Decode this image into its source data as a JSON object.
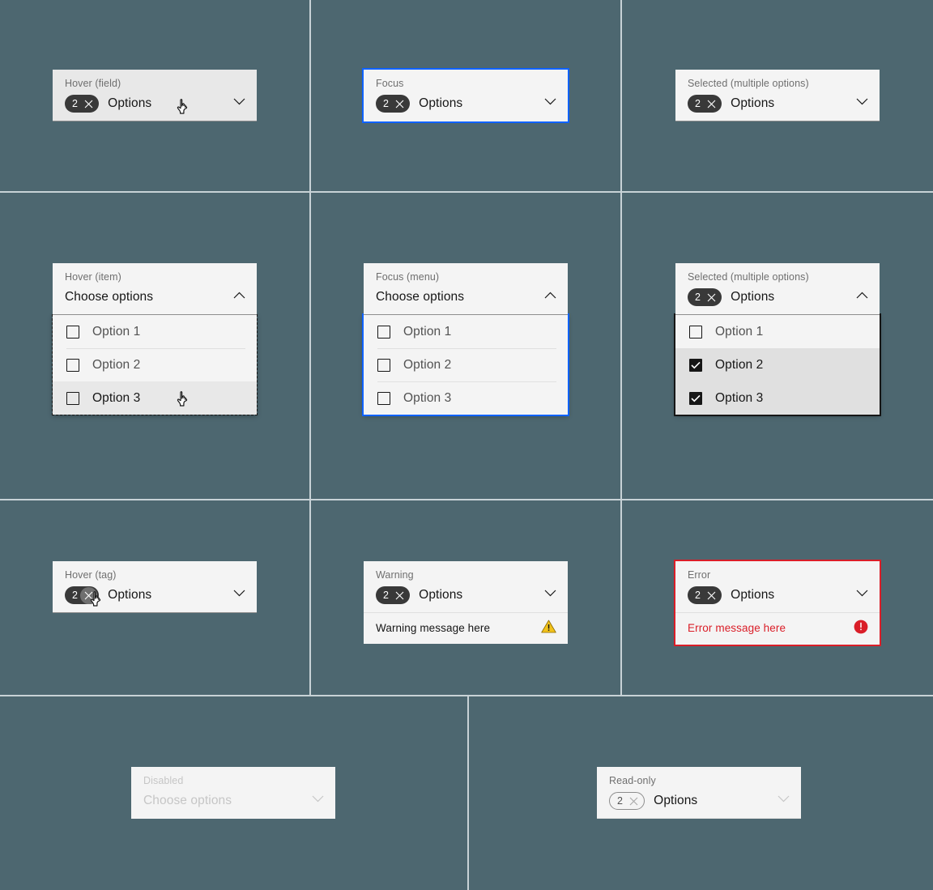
{
  "page": {
    "background_color": "#4d6770",
    "divider_color": "#c8d2d6",
    "accent_focus": "#0f62fe",
    "accent_error": "#da1e28",
    "accent_warning": "#f1c21b",
    "tag_fill": "#393939",
    "field_fill": "#f4f4f4",
    "field_hover_fill": "#e8e8e8"
  },
  "common": {
    "tag_count": "2",
    "options_value": "Options",
    "placeholder": "Choose options",
    "close_icon": "close-icon",
    "chevron_down_icon": "chevron-down-icon",
    "chevron_up_icon": "chevron-up-icon"
  },
  "menu_items": [
    {
      "label": "Option 1"
    },
    {
      "label": "Option 2"
    },
    {
      "label": "Option 3"
    }
  ],
  "cells": {
    "hover_field": {
      "label": "Hover (field)",
      "tag_count": "2",
      "value": "Options",
      "chevron": "chevron-down-icon",
      "cursor": "pointer-hand-cursor"
    },
    "focus": {
      "label": "Focus",
      "tag_count": "2",
      "value": "Options",
      "chevron": "chevron-down-icon"
    },
    "selected_multiple": {
      "label": "Selected (multiple options)",
      "tag_count": "2",
      "value": "Options",
      "chevron": "chevron-down-icon"
    },
    "hover_item": {
      "label": "Hover (item)",
      "value": "Choose options",
      "chevron": "chevron-up-icon",
      "items": [
        {
          "label": "Option 1",
          "checked": false,
          "state": "default"
        },
        {
          "label": "Option 2",
          "checked": false,
          "state": "default"
        },
        {
          "label": "Option 3",
          "checked": false,
          "state": "hover"
        }
      ],
      "cursor": "pointer-hand-cursor"
    },
    "focus_menu": {
      "label": "Focus (menu)",
      "value": "Choose options",
      "chevron": "chevron-up-icon",
      "items": [
        {
          "label": "Option 1",
          "checked": false,
          "state": "default"
        },
        {
          "label": "Option 2",
          "checked": false,
          "state": "default"
        },
        {
          "label": "Option 3",
          "checked": false,
          "state": "default"
        }
      ]
    },
    "selected_multiple_open": {
      "label": "Selected (multiple options)",
      "tag_count": "2",
      "value": "Options",
      "chevron": "chevron-up-icon",
      "items": [
        {
          "label": "Option 1",
          "checked": false,
          "state": "default"
        },
        {
          "label": "Option 2",
          "checked": true,
          "state": "selected"
        },
        {
          "label": "Option 3",
          "checked": true,
          "state": "selected"
        }
      ]
    },
    "hover_tag": {
      "label": "Hover (tag)",
      "tag_count": "2",
      "value": "Options",
      "chevron": "chevron-down-icon",
      "cursor": "pointer-hand-cursor"
    },
    "warning": {
      "label": "Warning",
      "tag_count": "2",
      "value": "Options",
      "chevron": "chevron-down-icon",
      "message": "Warning message here",
      "message_icon": "warning-triangle-icon"
    },
    "error": {
      "label": "Error",
      "tag_count": "2",
      "value": "Options",
      "chevron": "chevron-down-icon",
      "message": "Error message here",
      "message_icon": "error-circle-icon"
    },
    "disabled": {
      "label": "Disabled",
      "value": "Choose options",
      "chevron": "chevron-down-icon"
    },
    "readonly": {
      "label": "Read-only",
      "tag_count": "2",
      "value": "Options",
      "chevron": "chevron-down-icon"
    }
  }
}
